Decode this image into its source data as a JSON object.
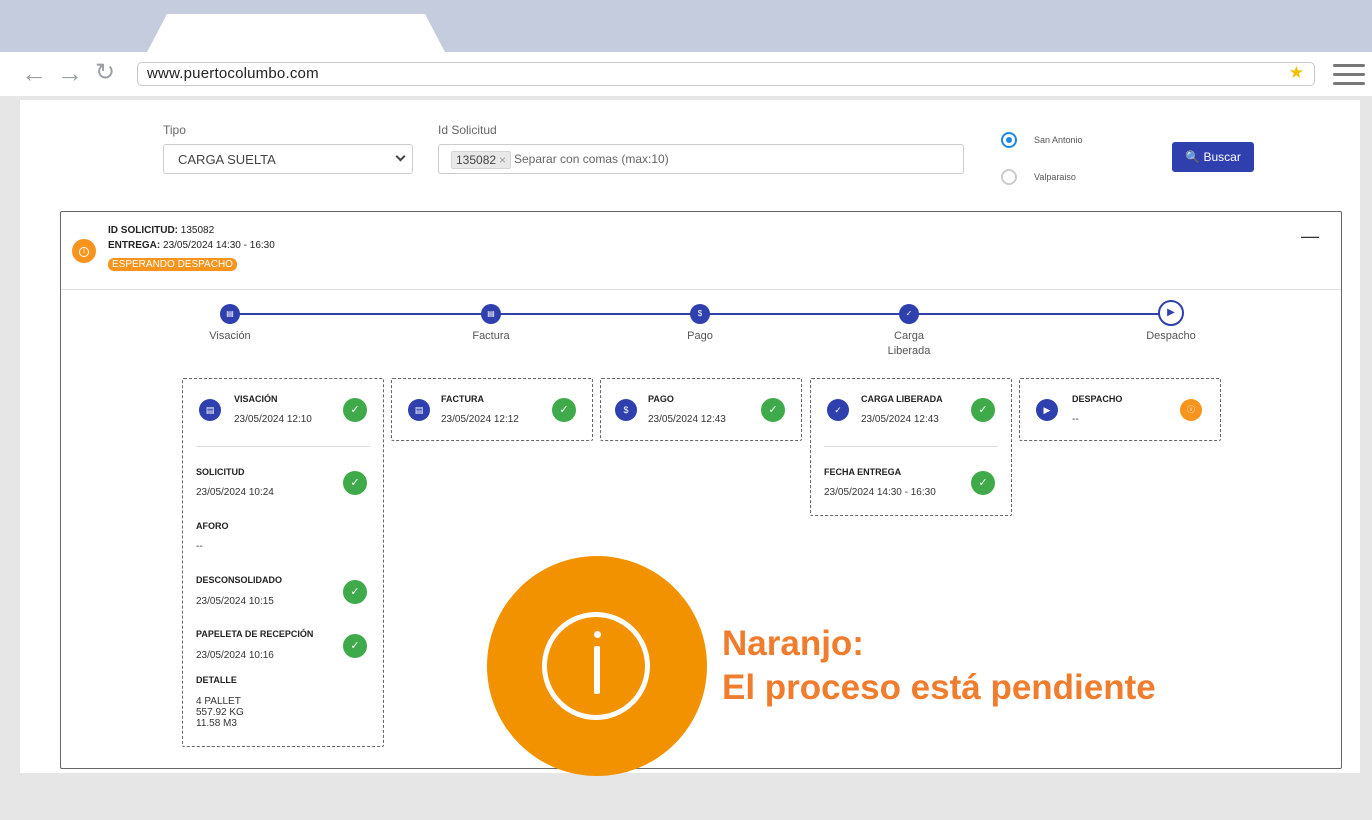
{
  "browser": {
    "url": "www.puertocolumbo.com",
    "back_icon": "←",
    "forward_icon": "→",
    "reload_icon": "↻",
    "star_icon": "★"
  },
  "filters": {
    "tipo_label": "Tipo",
    "tipo_value": "CARGA SUELTA",
    "id_label": "Id Solicitud",
    "id_chip": "135082",
    "chip_remove": "×",
    "id_placeholder": "Separar con comas (max:10)",
    "ports": [
      "San Antonio",
      "Valparaiso"
    ],
    "search_button": "🔍 Buscar"
  },
  "request": {
    "id_label": "ID SOLICITUD:",
    "id_value": "135082",
    "delivery_label": "ENTREGA:",
    "delivery_value": "23/05/2024 14:30 - 16:30",
    "status": "ESPERANDO DESPACHO",
    "collapse": "—"
  },
  "steps": [
    "Visación",
    "Factura",
    "Pago",
    "Carga Liberada",
    "Despacho"
  ],
  "cards": {
    "visacion": {
      "title": "VISACIÓN",
      "date": "23/05/2024 12:10",
      "sub": [
        {
          "title": "SOLICITUD",
          "date": "23/05/2024 10:24"
        },
        {
          "title": "AFORO",
          "date": "--"
        },
        {
          "title": "DESCONSOLIDADO",
          "date": "23/05/2024 10:15"
        },
        {
          "title": "PAPELETA DE RECEPCIÓN",
          "date": "23/05/2024 10:16"
        }
      ],
      "detail_title": "DETALLE",
      "detail_lines": [
        "4 PALLET",
        "557.92 KG",
        "11.58 M3"
      ]
    },
    "factura": {
      "title": "FACTURA",
      "date": "23/05/2024 12:12"
    },
    "pago": {
      "title": "PAGO",
      "date": "23/05/2024 12:43"
    },
    "carga": {
      "title": "CARGA LIBERADA",
      "date": "23/05/2024 12:43",
      "sub_title": "FECHA ENTREGA",
      "sub_date": "23/05/2024 14:30 - 16:30"
    },
    "despacho": {
      "title": "DESPACHO",
      "date": "--"
    }
  },
  "legend": {
    "line1": "Naranjo:",
    "line2": "El proceso está pendiente"
  },
  "colors": {
    "primary": "#2f3fad",
    "success": "#3faa4a",
    "pending": "#f7941d"
  }
}
